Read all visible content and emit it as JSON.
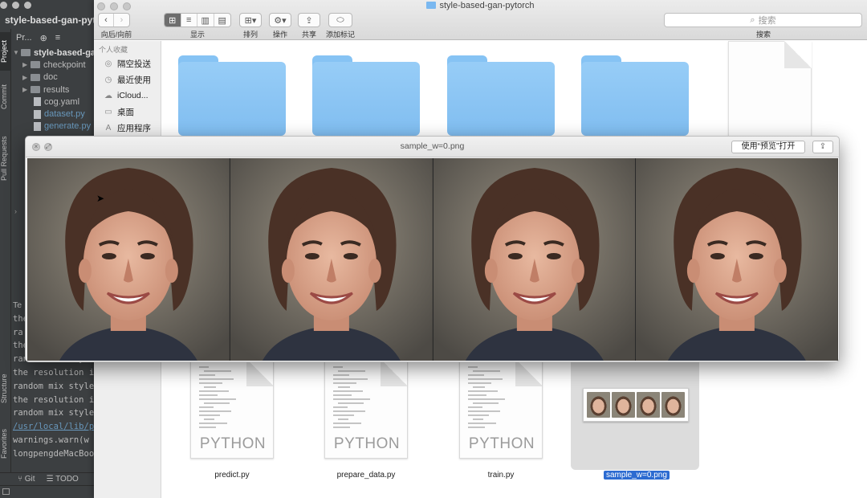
{
  "ide": {
    "title": "style-based-gan-pytorch",
    "side_tabs": [
      "Project",
      "Commit",
      "Pull Requests",
      "Structure",
      "Favorites"
    ],
    "project_toolbar_label": "Pr...",
    "tree": [
      {
        "label": "style-based-gan-pytorch",
        "kind": "folder-open"
      },
      {
        "label": "checkpoint",
        "kind": "folder"
      },
      {
        "label": "doc",
        "kind": "folder"
      },
      {
        "label": "results",
        "kind": "folder"
      },
      {
        "label": "cog.yaml",
        "kind": "file"
      },
      {
        "label": "dataset.py",
        "kind": "file"
      },
      {
        "label": "generate.py",
        "kind": "file"
      }
    ],
    "terminal_header": "Te",
    "terminal": [
      "the",
      "ra",
      "the",
      "random mix style",
      "the resolution is",
      "random mix style",
      "the resolution is",
      "random mix style",
      "/usr/local/lib/py",
      "  warnings.warn(w",
      "longpengdeMacBook"
    ],
    "bottom_tabs": [
      "Git",
      "TODO"
    ]
  },
  "finder": {
    "title": "style-based-gan-pytorch",
    "toolbar": {
      "back_forward_label": "向后/向前",
      "view_label": "显示",
      "sort_label": "排列",
      "action_label": "操作",
      "share_label": "共享",
      "tags_label": "添加标记",
      "search_label": "搜索",
      "search_placeholder": "搜索"
    },
    "sidebar": {
      "heading": "个人收藏",
      "items": [
        {
          "label": "隔空投送",
          "icon": "airdrop-icon"
        },
        {
          "label": "最近使用",
          "icon": "clock-icon"
        },
        {
          "label": "iCloud...",
          "icon": "cloud-icon"
        },
        {
          "label": "桌面",
          "icon": "desktop-icon"
        },
        {
          "label": "应用程序",
          "icon": "applications-icon"
        }
      ]
    },
    "files": [
      {
        "name": "predict.py",
        "kind_label": "PYTHON"
      },
      {
        "name": "prepare_data.py",
        "kind_label": "PYTHON"
      },
      {
        "name": "train.py",
        "kind_label": "PYTHON"
      },
      {
        "name": "sample_w=0.png",
        "selected": true
      }
    ]
  },
  "quicklook": {
    "title": "sample_w=0.png",
    "open_with_label": "使用“预览”打开",
    "face_count": 4
  }
}
